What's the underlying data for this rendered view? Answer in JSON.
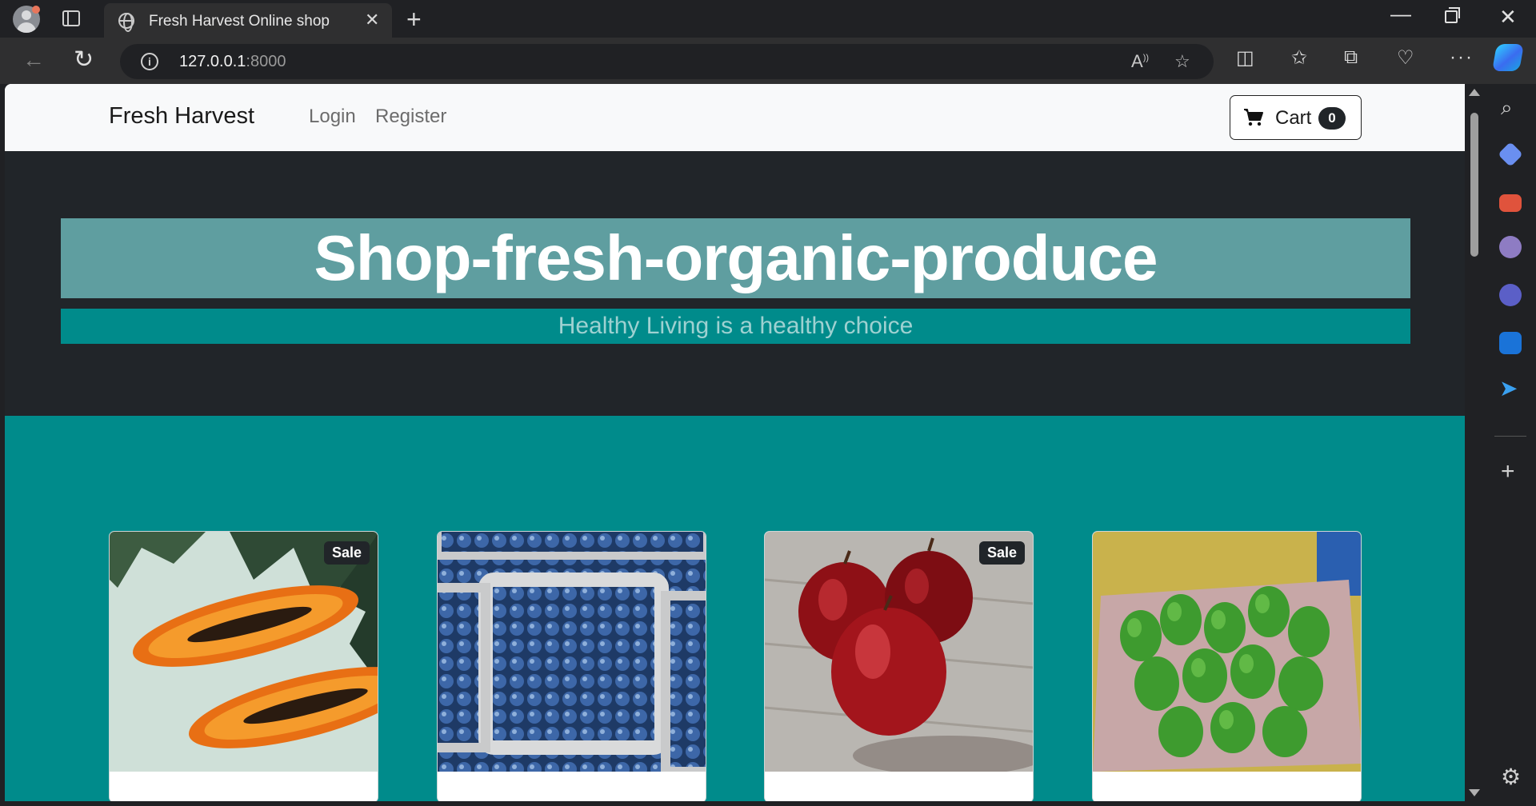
{
  "browser": {
    "tab_title": "Fresh Harvest Online shop",
    "url_host": "127.0.0.1",
    "url_port": ":8000"
  },
  "navbar": {
    "brand": "Fresh Harvest",
    "links": [
      "Login",
      "Register"
    ],
    "cart_label": "Cart",
    "cart_count": "0"
  },
  "hero": {
    "title": "Shop-fresh-organic-produce",
    "subtitle": "Healthy Living is a healthy choice"
  },
  "products": [
    {
      "image": "papaya-halves",
      "badge": "Sale"
    },
    {
      "image": "blueberries-in-cartons",
      "badge": ""
    },
    {
      "image": "red-apples",
      "badge": "Sale"
    },
    {
      "image": "avocados-in-basket",
      "badge": ""
    }
  ],
  "colors": {
    "hero_bg": "#212529",
    "title_bar": "#5f9ea0",
    "subtitle_bar": "#008b8b",
    "products_bg": "#008b8b"
  }
}
